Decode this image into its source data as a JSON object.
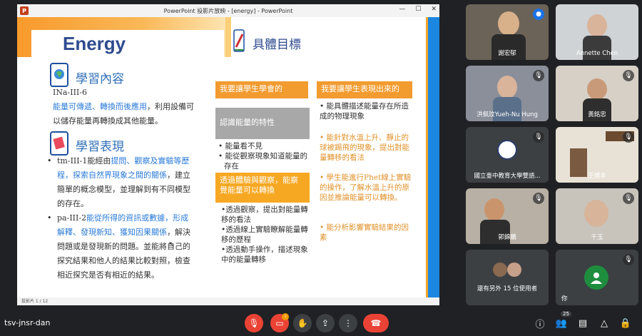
{
  "window": {
    "title": "PowerPoint 投影片放映 - [energy] - PowerPoint",
    "app_letter": "P",
    "status": "投影片 1 / 12"
  },
  "slide": {
    "heading": "Energy",
    "right_heading": "具體目標",
    "section1_title": "學習內容",
    "code": "INa-III-6",
    "content_blue": "能量可傳遞、轉換而後應用",
    "content_rest1": "，利用設備可",
    "content_rest2": "以儲存能量再轉換成其他能量。",
    "section2_title": "學習表現",
    "p1_a": "tm-III-1能經由",
    "p1_blue1": "提問、觀察及實驗等歷",
    "p1_blue2": "程，探索自然界現象之間的關係",
    "p1_b": "，建立",
    "p1_c": "簡單的概念模型，並理解到有不同模型",
    "p1_d": "的存在。",
    "p2_a": "pa-III-2",
    "p2_blue1": "能從所得的資訊或數據，形成",
    "p2_blue2": "解釋、發現新知、獲知因果關係",
    "p2_b": "，解決",
    "p2_c": "問題或是發現新的問題。並能將自己的",
    "p2_d": "探究結果和他人的結果比較對照，檢查",
    "p2_e": "相近探究是否有相近的結果。",
    "col1_header": "我要讓學生學會的",
    "col2_header": "我要讓學生表現出來的",
    "box_gray": "認識能量的特性",
    "col1_list1": [
      "能量看不見",
      "能從觀察現象知道能量的存在"
    ],
    "box_yellow": "透過體驗與觀察，能察覺能量可以轉換",
    "col1_list2": [
      "•透過觀察，提出對能量轉移的看法",
      "•透過線上實驗瞭解能量轉移的歷程",
      "•透過動手操作，描述現象中的能量轉移"
    ],
    "col2_items": [
      "能具體描述能量存在所造成的物理現象",
      "能針對水溫上升、靜止的球被踢飛的現象，提出對能量轉移的看法",
      "學生能進行Phet線上實驗的操作，了解水溫上升的原因並推論能量可以轉換。",
      "能分析影響實驗結果的因素"
    ]
  },
  "participants": [
    {
      "name": "謝宏郁"
    },
    {
      "name": "Annette Chen"
    },
    {
      "name": "洪佩玟Yueh-Nu Hung"
    },
    {
      "name": "黃銘忠"
    },
    {
      "name": "國立臺中教育大學雙語..."
    },
    {
      "name": "王博丰"
    },
    {
      "name": "郭錦鵬"
    },
    {
      "name": "千玉"
    },
    {
      "name": "還有另外 15 位使用者"
    },
    {
      "name": "你"
    }
  ],
  "bottom": {
    "meeting_code": "tsv-jnsr-dan",
    "people_count": "25",
    "alert": "!"
  },
  "colors": {
    "accent_orange": "#f29b2f",
    "accent_blue": "#1c87e0",
    "end_call": "#ea4335"
  }
}
